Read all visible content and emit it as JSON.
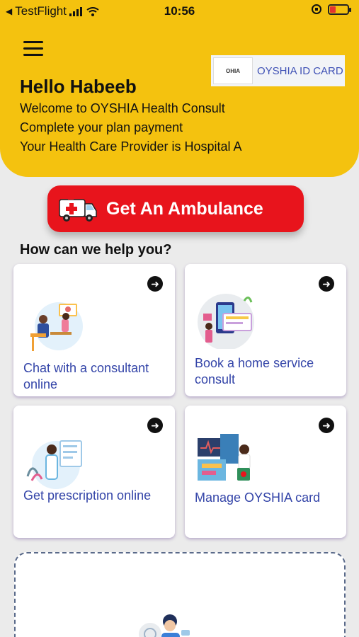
{
  "status": {
    "back_app": "TestFlight",
    "time": "10:56"
  },
  "header": {
    "id_card_logo": "OHIA",
    "id_card_label": "OYSHIA ID CARD",
    "greeting": "Hello Habeeb",
    "welcome": "Welcome to OYSHIA Health Consult",
    "plan_notice": "Complete your plan payment",
    "provider": "Your Health Care Provider is Hospital A",
    "bg_color": "#f4c20f"
  },
  "ambulance": {
    "label": "Get An Ambulance",
    "color": "#e8141c"
  },
  "help_title": "How can we help you?",
  "services": [
    {
      "label": "Chat with a consultant online",
      "icon": "consultant-chat-illustration"
    },
    {
      "label": "Book a home service consult",
      "icon": "home-service-illustration"
    },
    {
      "label": "Get prescription online",
      "icon": "prescription-illustration"
    },
    {
      "label": "Manage OYSHIA card",
      "icon": "manage-card-illustration"
    }
  ]
}
